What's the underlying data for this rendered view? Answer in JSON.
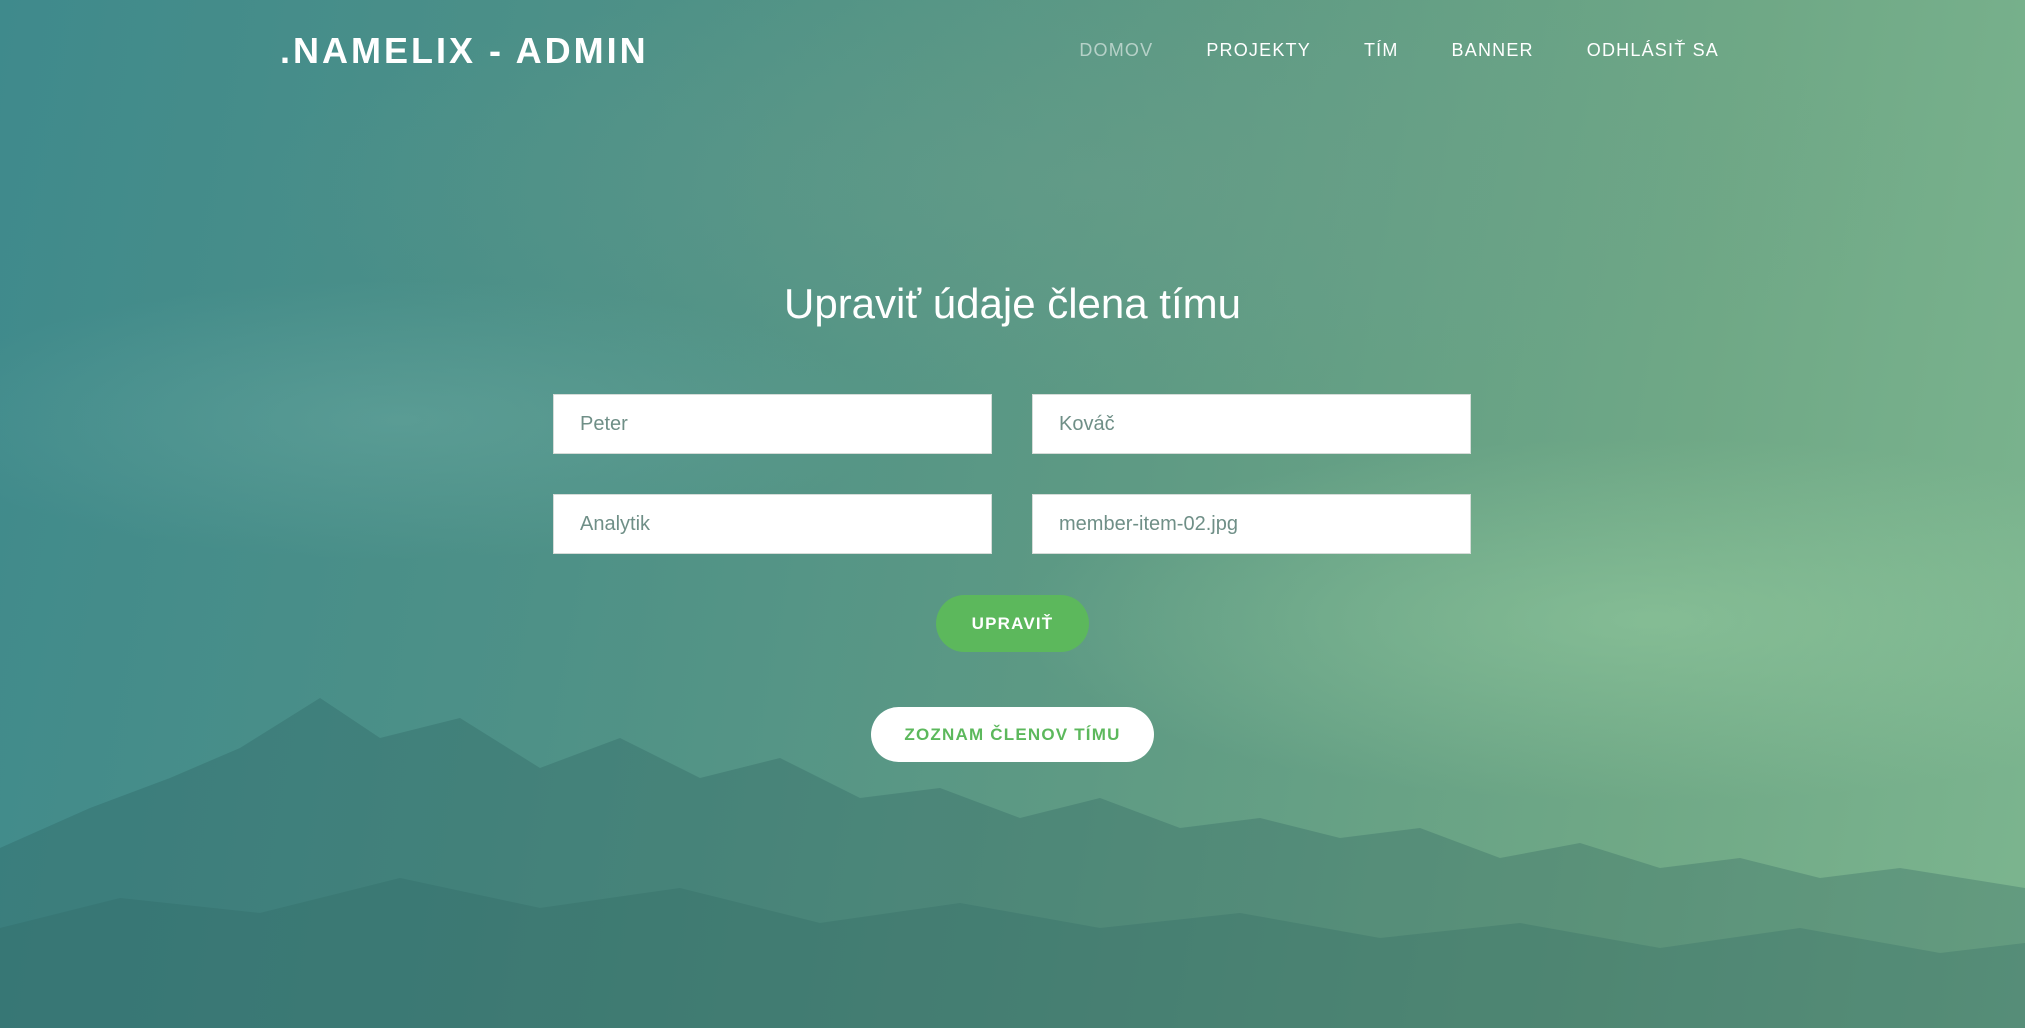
{
  "brand": ".NAMELIX - ADMIN",
  "nav": {
    "items": [
      {
        "label": "DOMOV",
        "active": true
      },
      {
        "label": "PROJEKTY",
        "active": false
      },
      {
        "label": "TÍM",
        "active": false
      },
      {
        "label": "BANNER",
        "active": false
      },
      {
        "label": "ODHLÁSIŤ SA",
        "active": false
      }
    ]
  },
  "form": {
    "title": "Upraviť údaje člena tímu",
    "first_name": "Peter",
    "last_name": "Kováč",
    "position": "Analytik",
    "image": "member-item-02.jpg",
    "submit_label": "UPRAVIŤ"
  },
  "list_button_label": "ZOZNAM ČLENOV TÍMU",
  "colors": {
    "accent": "#5cb85c",
    "background_start": "#3f8a8c",
    "background_end": "#7cb58f",
    "nav_active": "rgba(255,255,255,0.55)"
  }
}
